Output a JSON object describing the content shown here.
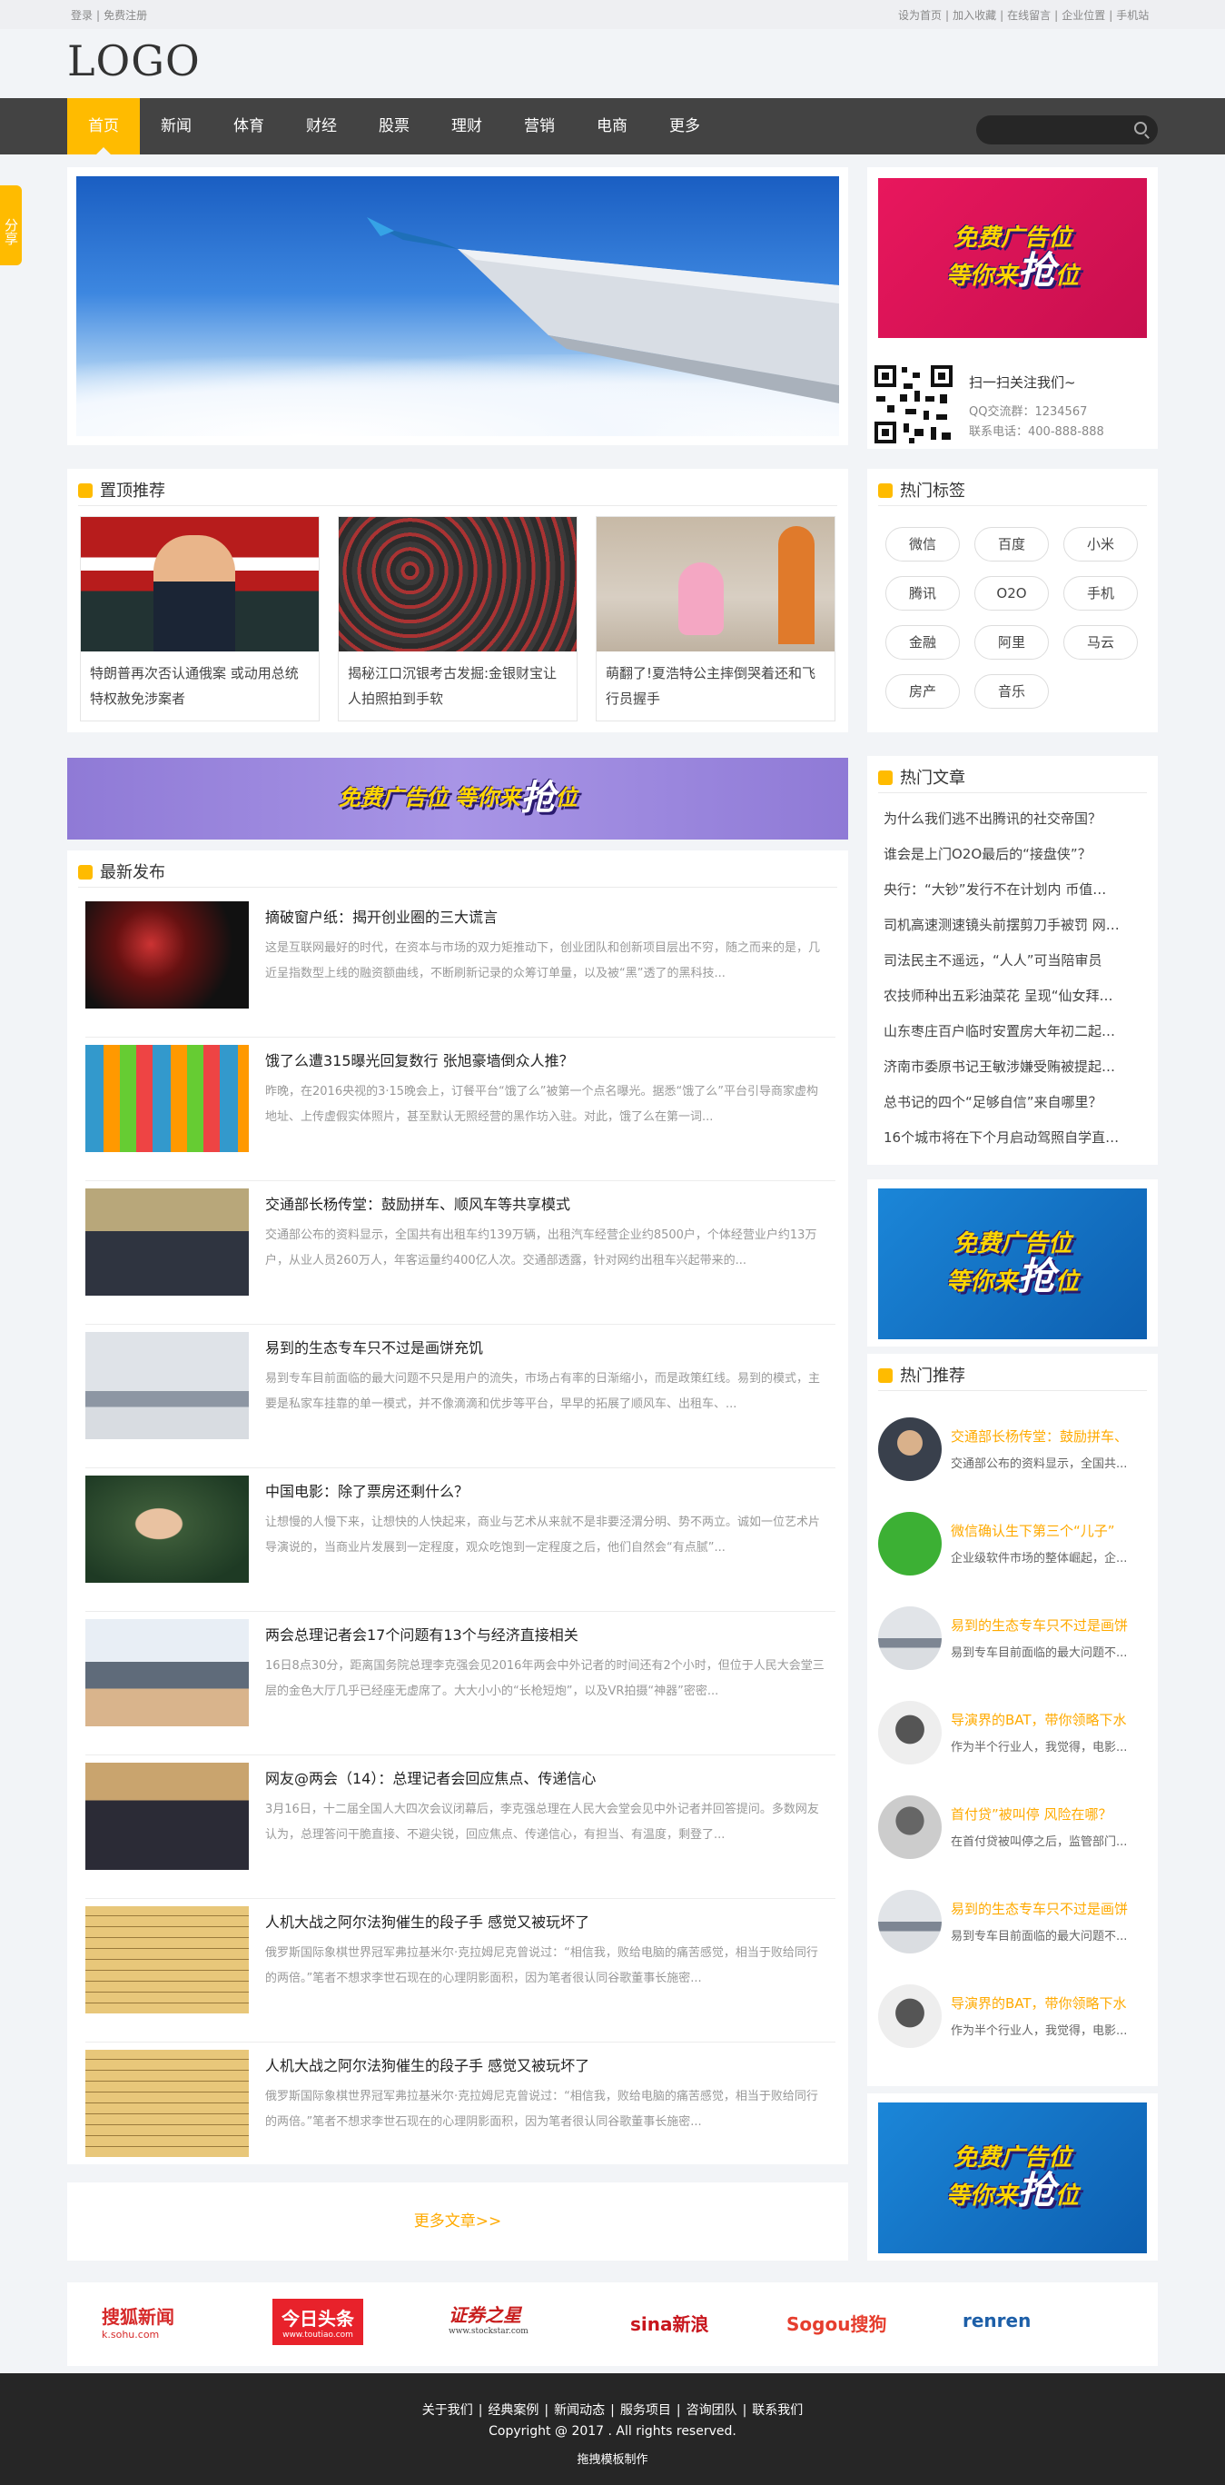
{
  "topbar": {
    "login": "登录",
    "register": "免费注册",
    "links": [
      "设为首页",
      "加入收藏",
      "在线留言",
      "企业位置",
      "手机站"
    ]
  },
  "logo": "LOGO",
  "nav": {
    "items": [
      "首页",
      "新闻",
      "体育",
      "财经",
      "股票",
      "理财",
      "营销",
      "电商",
      "更多"
    ],
    "active_index": 0
  },
  "share": "分享",
  "ad_text": {
    "line1": "免费广告位",
    "line2a": "等你来",
    "line2b": "抢",
    "line2c": "位"
  },
  "qr": {
    "title": "扫一扫关注我们~",
    "qq": "QQ交流群：1234567",
    "phone": "联系电话：400-888-888"
  },
  "featured": {
    "title": "置顶推荐",
    "items": [
      {
        "title": "特朗普再次否认通俄案 或动用总统特权赦免涉案者"
      },
      {
        "title": "揭秘江口沉银考古发掘:金银财宝让人拍照拍到手软"
      },
      {
        "title": "萌翻了!夏浩特公主摔倒哭着还和飞行员握手"
      }
    ]
  },
  "tags": {
    "title": "热门标签",
    "items": [
      "微信",
      "百度",
      "小米",
      "腾讯",
      "O2O",
      "手机",
      "金融",
      "阿里",
      "马云",
      "房产",
      "音乐"
    ]
  },
  "hot_articles": {
    "title": "热门文章",
    "items": [
      "为什么我们逃不出腾讯的社交帝国？",
      "谁会是上门O2O最后的“接盘侠”？",
      "央行：“大钞”发行不在计划内 币值…",
      "司机高速测速镜头前摆剪刀手被罚 网…",
      "司法民主不遥远，“人人”可当陪审员",
      "农技师种出五彩油菜花 呈现“仙女拜…",
      "山东枣庄百户临时安置房大年初二起…",
      "济南市委原书记王敏涉嫌受贿被提起…",
      "总书记的四个“足够自信”来自哪里？",
      "16个城市将在下个月启动驾照自学直…"
    ]
  },
  "latest": {
    "title": "最新发布",
    "items": [
      {
        "title": "摘破窗户纸：揭开创业圈的三大谎言",
        "desc": "这是互联网最好的时代，在资本与市场的双力矩推动下，创业团队和创新项目层出不穷，随之而来的是，几近呈指数型上线的融资额曲线，不断刷新记录的众筹订单量，以及被“黑”透了的黑科技..."
      },
      {
        "title": "饿了么遭315曝光回复数行 张旭豪墙倒众人推？",
        "desc": "昨晚，在2016央视的3·15晚会上，订餐平台“饿了么”被第一个点名曝光。据悉“饿了么”平台引导商家虚构地址、上传虚假实体照片，甚至默认无照经营的黑作坊入驻。对此，饿了么在第一词..."
      },
      {
        "title": "交通部长杨传堂：鼓励拼车、顺风车等共享模式",
        "desc": "交通部公布的资料显示，全国共有出租车约139万辆，出租汽车经营企业约8500户，个体经营业户约13万户，从业人员260万人，年客运量约400亿人次。交通部透露，针对网约出租车兴起带来的..."
      },
      {
        "title": "易到的生态专车只不过是画饼充饥",
        "desc": "易到专车目前面临的最大问题不只是用户的流失，市场占有率的日渐缩小，而是政策红线。易到的模式，主要是私家车挂靠的单一模式，并不像滴滴和优步等平台，早早的拓展了顺风车、出租车、..."
      },
      {
        "title": "中国电影：除了票房还剩什么？",
        "desc": "让想慢的人慢下来，让想快的人快起来，商业与艺术从来就不是非要泾渭分明、势不两立。诚如一位艺术片导演说的，当商业片发展到一定程度，观众吃饱到一定程度之后，他们自然会“有点腻”..."
      },
      {
        "title": "两会总理记者会17个问题有13个与经济直接相关",
        "desc": "16日8点30分，距离国务院总理李克强会见2016年两会中外记者的时间还有2个小时，但位于人民大会堂三层的金色大厅几乎已经座无虚席了。大大小小的“长枪短炮”，以及VR拍摄“神器”密密..."
      },
      {
        "title": "网友@两会（14）：总理记者会回应焦点、传递信心",
        "desc": "3月16日，十二届全国人大四次会议闭幕后，李克强总理在人民大会堂会见中外记者并回答提问。多数网友认为，总理答问干脆直接、不避尖锐，回应焦点、传递信心，有担当、有温度，剩登了..."
      },
      {
        "title": "人机大战之阿尔法狗催生的段子手 感觉又被玩坏了",
        "desc": "俄罗斯国际象棋世界冠军弗拉基米尔·克拉姆尼克曾说过：“相信我，败给电脑的痛苦感觉，相当于败给同行的两倍。”笔者不想求李世石现在的心理阴影面积，因为笔者很认同谷歌董事长施密..."
      },
      {
        "title": "人机大战之阿尔法狗催生的段子手 感觉又被玩坏了",
        "desc": "俄罗斯国际象棋世界冠军弗拉基米尔·克拉姆尼克曾说过：“相信我，败给电脑的痛苦感觉，相当于败给同行的两倍。”笔者不想求李世石现在的心理阴影面积，因为笔者很认同谷歌董事长施密..."
      }
    ],
    "more": "更多文章>>"
  },
  "recommend": {
    "title": "热门推荐",
    "items": [
      {
        "title": "交通部长杨传堂：鼓励拼车、",
        "desc": "交通部公布的资料显示，全国共..."
      },
      {
        "title": "微信确认生下第三个“儿子”",
        "desc": "企业级软件市场的整体崛起，企..."
      },
      {
        "title": "易到的生态专车只不过是画饼",
        "desc": "易到专车目前面临的最大问题不..."
      },
      {
        "title": "导演界的BAT，带你领略下水",
        "desc": "作为半个行业人，我觉得，电影..."
      },
      {
        "title": "首付贷”被叫停 风险在哪？",
        "desc": "在首付贷被叫停之后，监管部门..."
      },
      {
        "title": "易到的生态专车只不过是画饼",
        "desc": "易到专车目前面临的最大问题不..."
      },
      {
        "title": "导演界的BAT，带你领略下水",
        "desc": "作为半个行业人，我觉得，电影..."
      }
    ]
  },
  "partners": [
    "搜狐新闻",
    "今日头条",
    "证券之星",
    "sina新浪",
    "Sogou搜狗",
    "renren"
  ],
  "partner_sub": {
    "sohu": "k.sohu.com",
    "toutiao": "www.toutiao.com",
    "stock": "www.stockstar.com"
  },
  "footer": {
    "links": [
      "关于我们",
      "经典案例",
      "新闻动态",
      "服务项目",
      "咨询团队",
      "联系我们"
    ],
    "copyright": "Copyright @ 2017 . All rights reserved.",
    "made_by": "拖拽模板制作"
  },
  "colors": {
    "accent": "#ffbb00",
    "nav_bg": "#434343",
    "footer_bg": "#262626",
    "link_orange": "#ffaa00"
  }
}
